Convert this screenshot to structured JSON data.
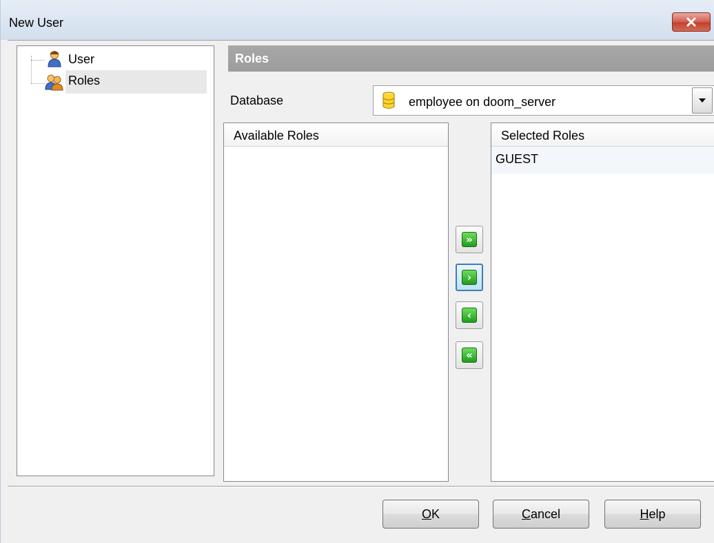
{
  "window": {
    "title": "New User"
  },
  "tree": {
    "items": [
      {
        "label": "User",
        "icon": "user-icon"
      },
      {
        "label": "Roles",
        "icon": "roles-icon",
        "selected": true
      }
    ]
  },
  "section": {
    "title": "Roles"
  },
  "database": {
    "label": "Database",
    "value": "employee on doom_server",
    "icon": "database-icon"
  },
  "available_roles": {
    "header": "Available Roles",
    "items": []
  },
  "selected_roles": {
    "header": "Selected Roles",
    "items": [
      "GUEST"
    ]
  },
  "move_buttons": [
    {
      "name": "add-all-button",
      "glyph": "»"
    },
    {
      "name": "add-button",
      "glyph": "›"
    },
    {
      "name": "remove-button",
      "glyph": "‹"
    },
    {
      "name": "remove-all-button",
      "glyph": "«"
    }
  ],
  "footer": {
    "ok": {
      "mnemonic": "O",
      "rest": "K"
    },
    "cancel": {
      "mnemonic": "C",
      "rest": "ancel"
    },
    "help": {
      "mnemonic": "H",
      "rest": "elp"
    }
  },
  "colors": {
    "section_header": "#9f9f9f",
    "move_glyph": "#2fae27",
    "close_button": "#c8473a"
  }
}
